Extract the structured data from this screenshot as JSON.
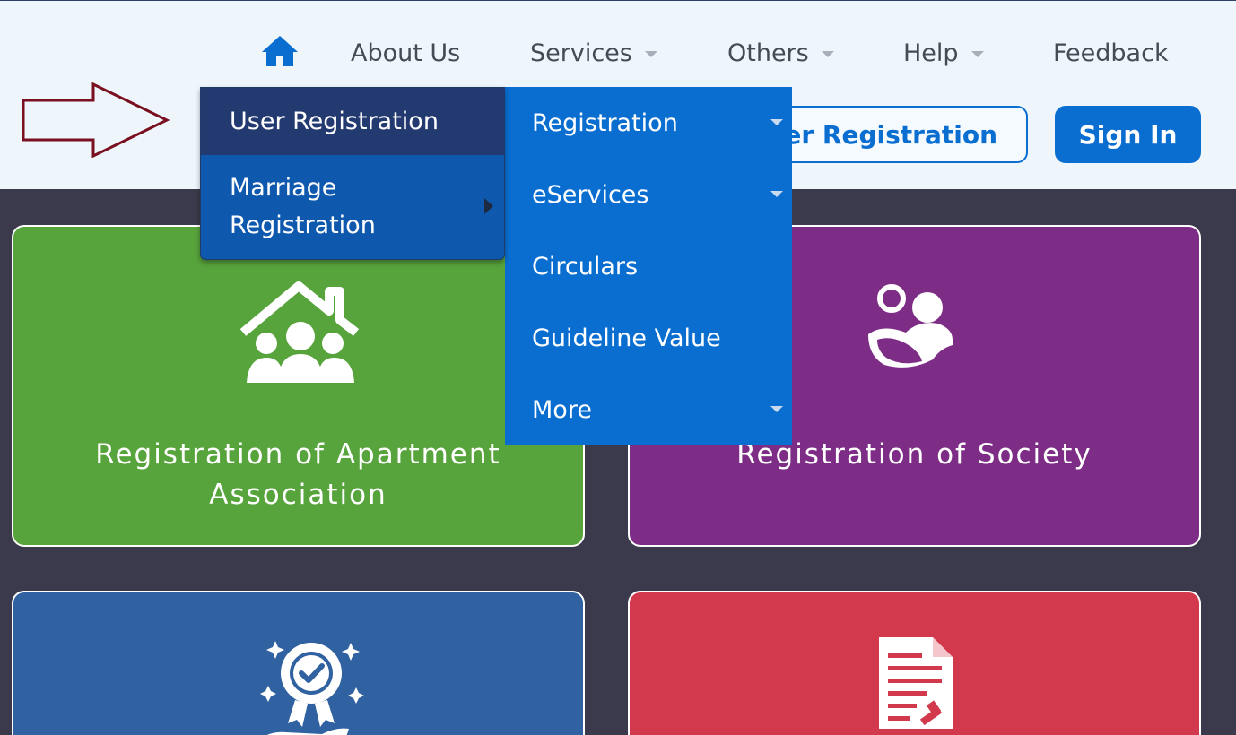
{
  "nav": {
    "home_icon": "home-icon",
    "about": "About Us",
    "services": "Services",
    "others": "Others",
    "help": "Help",
    "feedback": "Feedback"
  },
  "actions": {
    "user_registration": "User Registration",
    "sign_in": "Sign In"
  },
  "services_menu": {
    "items": [
      {
        "label": "Registration",
        "has_caret": true
      },
      {
        "label": "eServices",
        "has_caret": true
      },
      {
        "label": "Circulars",
        "has_caret": false
      },
      {
        "label": "Guideline Value",
        "has_caret": false
      },
      {
        "label": "More",
        "has_caret": true
      }
    ]
  },
  "registration_submenu": {
    "items": [
      {
        "label": "User Registration",
        "active": true
      },
      {
        "label": "Marriage Registration",
        "has_submenu": true
      }
    ]
  },
  "cards": [
    {
      "title": "Registration of Apartment Association",
      "color": "#57a33c",
      "icon": "family-house-icon"
    },
    {
      "title": "Registration of Society",
      "color": "#7d2d85",
      "icon": "society-people-icon"
    },
    {
      "title": "",
      "color": "#3061a0",
      "icon": "certificate-badge-icon"
    },
    {
      "title": "",
      "color": "#d2394c",
      "icon": "document-stamp-icon"
    }
  ],
  "colors": {
    "primary": "#0a6ed1",
    "header_bg": "#eef6fc",
    "page_bg": "#3b3a4c",
    "active_submenu": "#233a70",
    "annotation_arrow": "#7a0f1f"
  }
}
